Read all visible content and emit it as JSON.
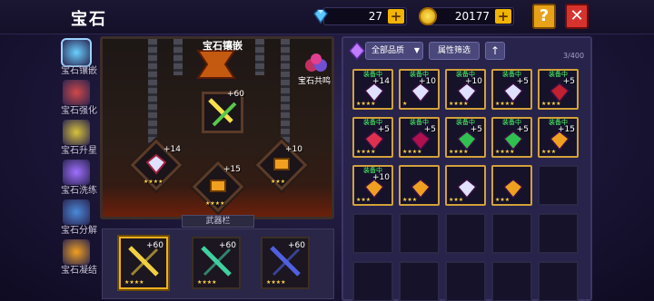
{
  "header": {
    "title": "宝石",
    "diamonds": "27",
    "coins": "20177",
    "help": "?",
    "close": "✕"
  },
  "sidebar": {
    "items": [
      {
        "label": "宝石镶嵌",
        "active": true,
        "color": "#6ad0ff"
      },
      {
        "label": "宝石强化",
        "active": false,
        "color": "#d04848"
      },
      {
        "label": "宝石升星",
        "active": false,
        "color": "#d8c33a"
      },
      {
        "label": "宝石洗练",
        "active": false,
        "color": "#a070ff"
      },
      {
        "label": "宝石分解",
        "active": false,
        "color": "#4a8ad8"
      },
      {
        "label": "宝石凝结",
        "active": false,
        "color": "#f0a020"
      }
    ]
  },
  "left": {
    "title": "宝石镶嵌",
    "resonance": "宝石共鸣",
    "main_slot": {
      "level": "+60"
    },
    "slots": [
      {
        "level": "+14",
        "stars": "★★★★"
      },
      {
        "level": "+15",
        "stars": "★★★★"
      },
      {
        "level": "+10",
        "stars": "★★★"
      }
    ],
    "weapons_title": "武器栏",
    "weapons": [
      {
        "level": "+60",
        "stars": "★★★★",
        "selected": true,
        "color": "#f0d040"
      },
      {
        "level": "+60",
        "stars": "★★★★",
        "selected": false,
        "color": "#40d0a0"
      },
      {
        "level": "+60",
        "stars": "★★★★",
        "selected": false,
        "color": "#5060e0"
      }
    ]
  },
  "right": {
    "filter_quality": "全部品质",
    "filter_attr": "属性筛选",
    "sort_icon": "up-arrow-icon",
    "count": "3/400",
    "equipped_tag": "装备中",
    "grid": [
      {
        "eq": true,
        "lv": "+14",
        "stars": "★★★★",
        "color": "#e0e0ff"
      },
      {
        "eq": true,
        "lv": "+10",
        "stars": "★",
        "color": "#e0e0ff"
      },
      {
        "eq": true,
        "lv": "+10",
        "stars": "★★★★",
        "color": "#e0e0ff"
      },
      {
        "eq": true,
        "lv": "+5",
        "stars": "★★★★",
        "color": "#e0e0ff"
      },
      {
        "eq": true,
        "lv": "+5",
        "stars": "★★★★",
        "color": "#c02030"
      },
      {
        "eq": true,
        "lv": "+5",
        "stars": "★★★★",
        "color": "#e03050"
      },
      {
        "eq": true,
        "lv": "+5",
        "stars": "★★★★",
        "color": "#b01050"
      },
      {
        "eq": true,
        "lv": "+5",
        "stars": "★★★★",
        "color": "#30c050"
      },
      {
        "eq": true,
        "lv": "+5",
        "stars": "★★★★",
        "color": "#30c050"
      },
      {
        "eq": true,
        "lv": "+15",
        "stars": "★★★",
        "color": "#f0a020"
      },
      {
        "eq": true,
        "lv": "+10",
        "stars": "★★★",
        "color": "#f0a020"
      },
      {
        "eq": false,
        "lv": "",
        "stars": "★★★",
        "color": "#f0a020"
      },
      {
        "eq": false,
        "lv": "",
        "stars": "★★★",
        "color": "#e0e0ff"
      },
      {
        "eq": false,
        "lv": "",
        "stars": "★★★",
        "color": "#f0a020"
      },
      {
        "eq": false,
        "lv": "",
        "stars": "",
        "color": ""
      },
      {
        "eq": false,
        "lv": "",
        "stars": "",
        "color": ""
      },
      {
        "eq": false,
        "lv": "",
        "stars": "",
        "color": ""
      },
      {
        "eq": false,
        "lv": "",
        "stars": "",
        "color": ""
      },
      {
        "eq": false,
        "lv": "",
        "stars": "",
        "color": ""
      },
      {
        "eq": false,
        "lv": "",
        "stars": "",
        "color": ""
      },
      {
        "eq": false,
        "lv": "",
        "stars": "",
        "color": ""
      },
      {
        "eq": false,
        "lv": "",
        "stars": "",
        "color": ""
      },
      {
        "eq": false,
        "lv": "",
        "stars": "",
        "color": ""
      },
      {
        "eq": false,
        "lv": "",
        "stars": "",
        "color": ""
      },
      {
        "eq": false,
        "lv": "",
        "stars": "",
        "color": ""
      }
    ]
  }
}
